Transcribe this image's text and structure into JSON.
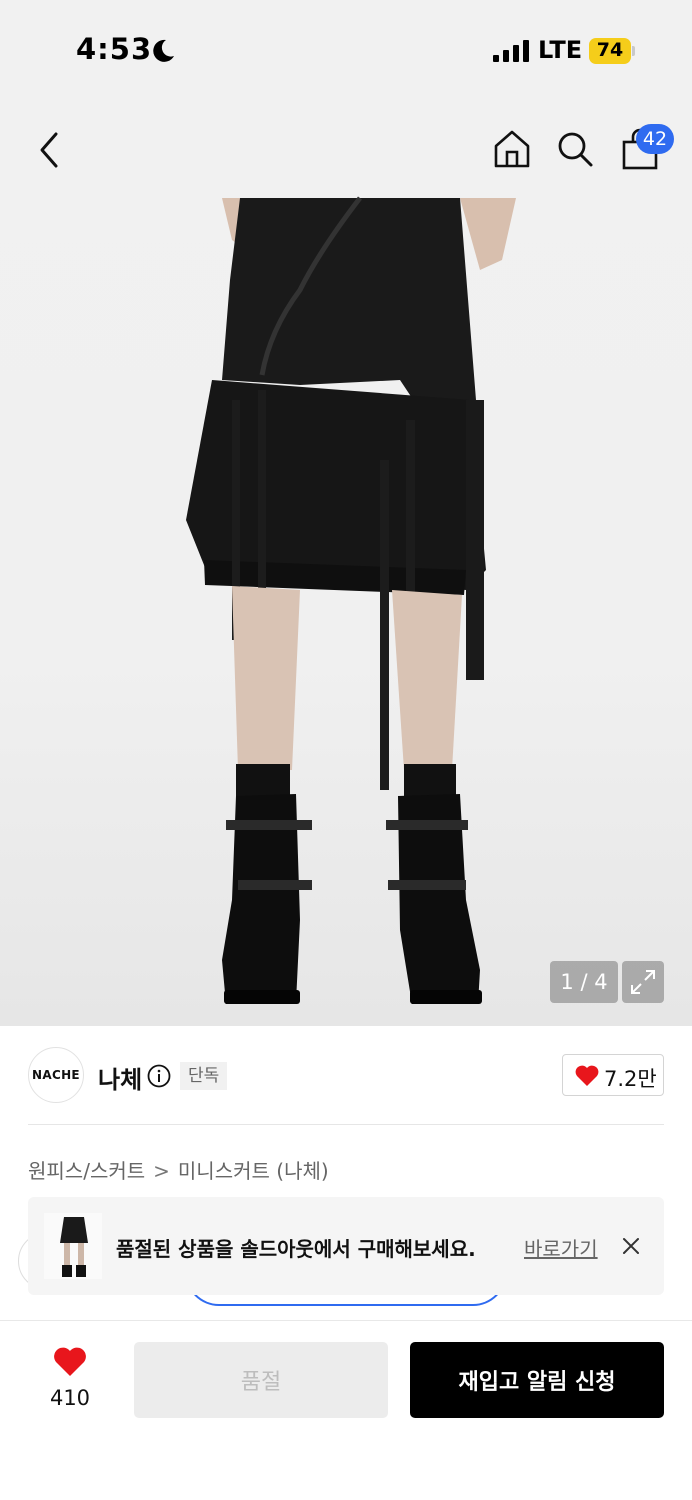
{
  "status_bar": {
    "time": "4:53",
    "network": "LTE",
    "battery": "74"
  },
  "nav": {
    "back_icon": "chevron-left-icon",
    "home_icon": "home-icon",
    "search_icon": "search-icon",
    "bag_icon": "shopping-bag-icon",
    "cart_count": "42"
  },
  "gallery": {
    "page_indicator": "1 / 4",
    "expand_icon": "expand-icon"
  },
  "brand": {
    "logo_text": "NACHE",
    "name": "나체",
    "badge": "단독",
    "likes": "7.2만"
  },
  "breadcrumb": {
    "category": "원피스/스커트",
    "separator": ">",
    "current": "미니스커트 (나체)"
  },
  "banner": {
    "text": "품절된 상품을 솔드아웃에서 구매해보세요.",
    "link": "바로가기"
  },
  "bottom_bar": {
    "wish_count": "410",
    "soldout_label": "품절",
    "restock_label": "재입고 알림 신청"
  },
  "colors": {
    "accent_blue": "#2f6bf0",
    "heart_red": "#e8161c",
    "battery_yellow": "#f5cd1a"
  }
}
